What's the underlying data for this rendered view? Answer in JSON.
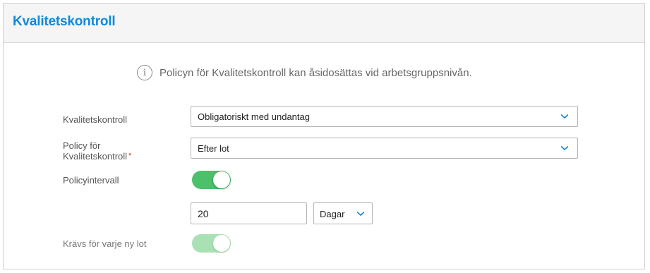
{
  "header": {
    "title": "Kvalitetskontroll"
  },
  "info": {
    "icon": "info-icon",
    "text": "Policyn för Kvalitetskontroll kan åsidosättas vid arbetsgruppsnivån."
  },
  "fields": {
    "quality_control": {
      "label": "Kvalitetskontroll",
      "value": "Obligatoriskt med undantag"
    },
    "policy": {
      "label_line1": "Policy för",
      "label_line2": "Kvalitetskontroll",
      "required_mark": "*",
      "value": "Efter lot"
    },
    "policy_interval": {
      "label": "Policyintervall",
      "toggle_on": true
    },
    "interval": {
      "value": "20",
      "unit": "Dagar"
    },
    "required_each_lot": {
      "label": "Krävs för varje ny lot",
      "toggle_on": true,
      "disabled": true
    }
  },
  "colors": {
    "accent": "#0f8ad9",
    "toggle_on": "#4cc06a",
    "toggle_disabled": "#a9e0b4",
    "required": "#d9262d"
  }
}
